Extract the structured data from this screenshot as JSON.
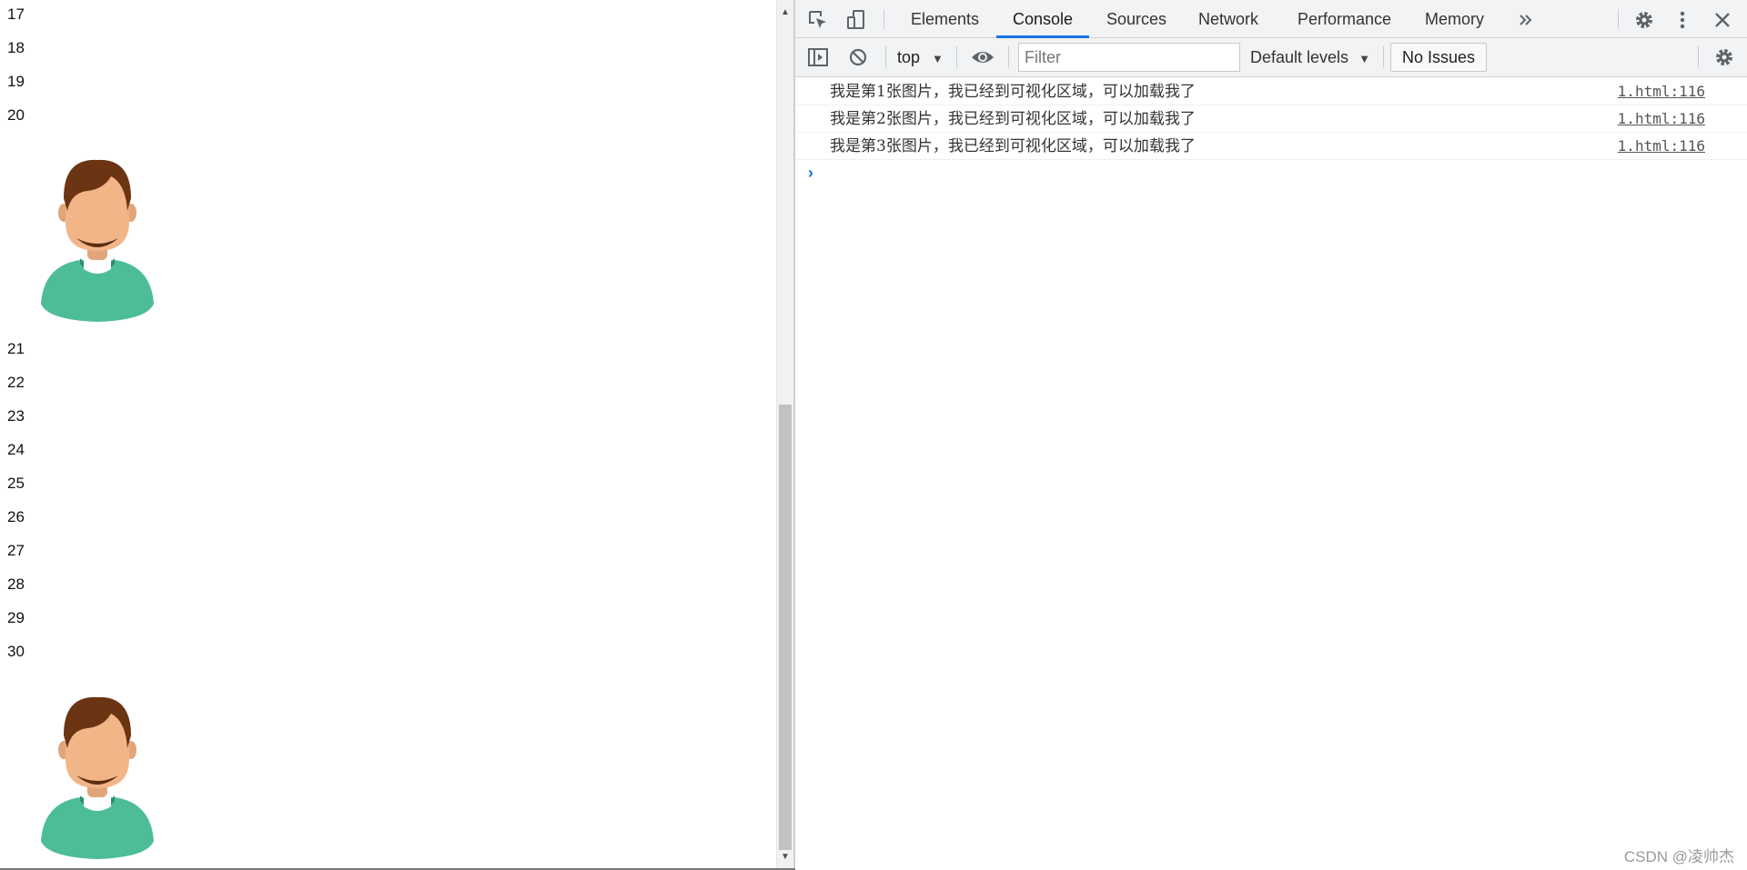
{
  "page": {
    "line_numbers_top": [
      "17",
      "18",
      "19",
      "20"
    ],
    "line_numbers_bottom": [
      "21",
      "22",
      "23",
      "24",
      "25",
      "26",
      "27",
      "28",
      "29",
      "30"
    ]
  },
  "devtools": {
    "tabs": [
      {
        "label": "Elements",
        "active": false
      },
      {
        "label": "Console",
        "active": true
      },
      {
        "label": "Sources",
        "active": false
      },
      {
        "label": "Network",
        "active": false
      },
      {
        "label": "Performance",
        "active": false
      },
      {
        "label": "Memory",
        "active": false
      }
    ],
    "more_tabs_icon": "chevrons-right-icon",
    "toolbar": {
      "context": "top",
      "filter_placeholder": "Filter",
      "levels": "Default levels",
      "issues": "No Issues"
    },
    "logs": [
      {
        "message": "我是第1张图片，我已经到可视化区域，可以加载我了",
        "source": "1.html:116"
      },
      {
        "message": "我是第2张图片，我已经到可视化区域，可以加载我了",
        "source": "1.html:116"
      },
      {
        "message": "我是第3张图片，我已经到可视化区域，可以加载我了",
        "source": "1.html:116"
      }
    ],
    "colors": {
      "accent": "#1a73e8",
      "toolbar_bg": "#f1f3f4"
    }
  },
  "watermark": "CSDN @凌帅杰"
}
